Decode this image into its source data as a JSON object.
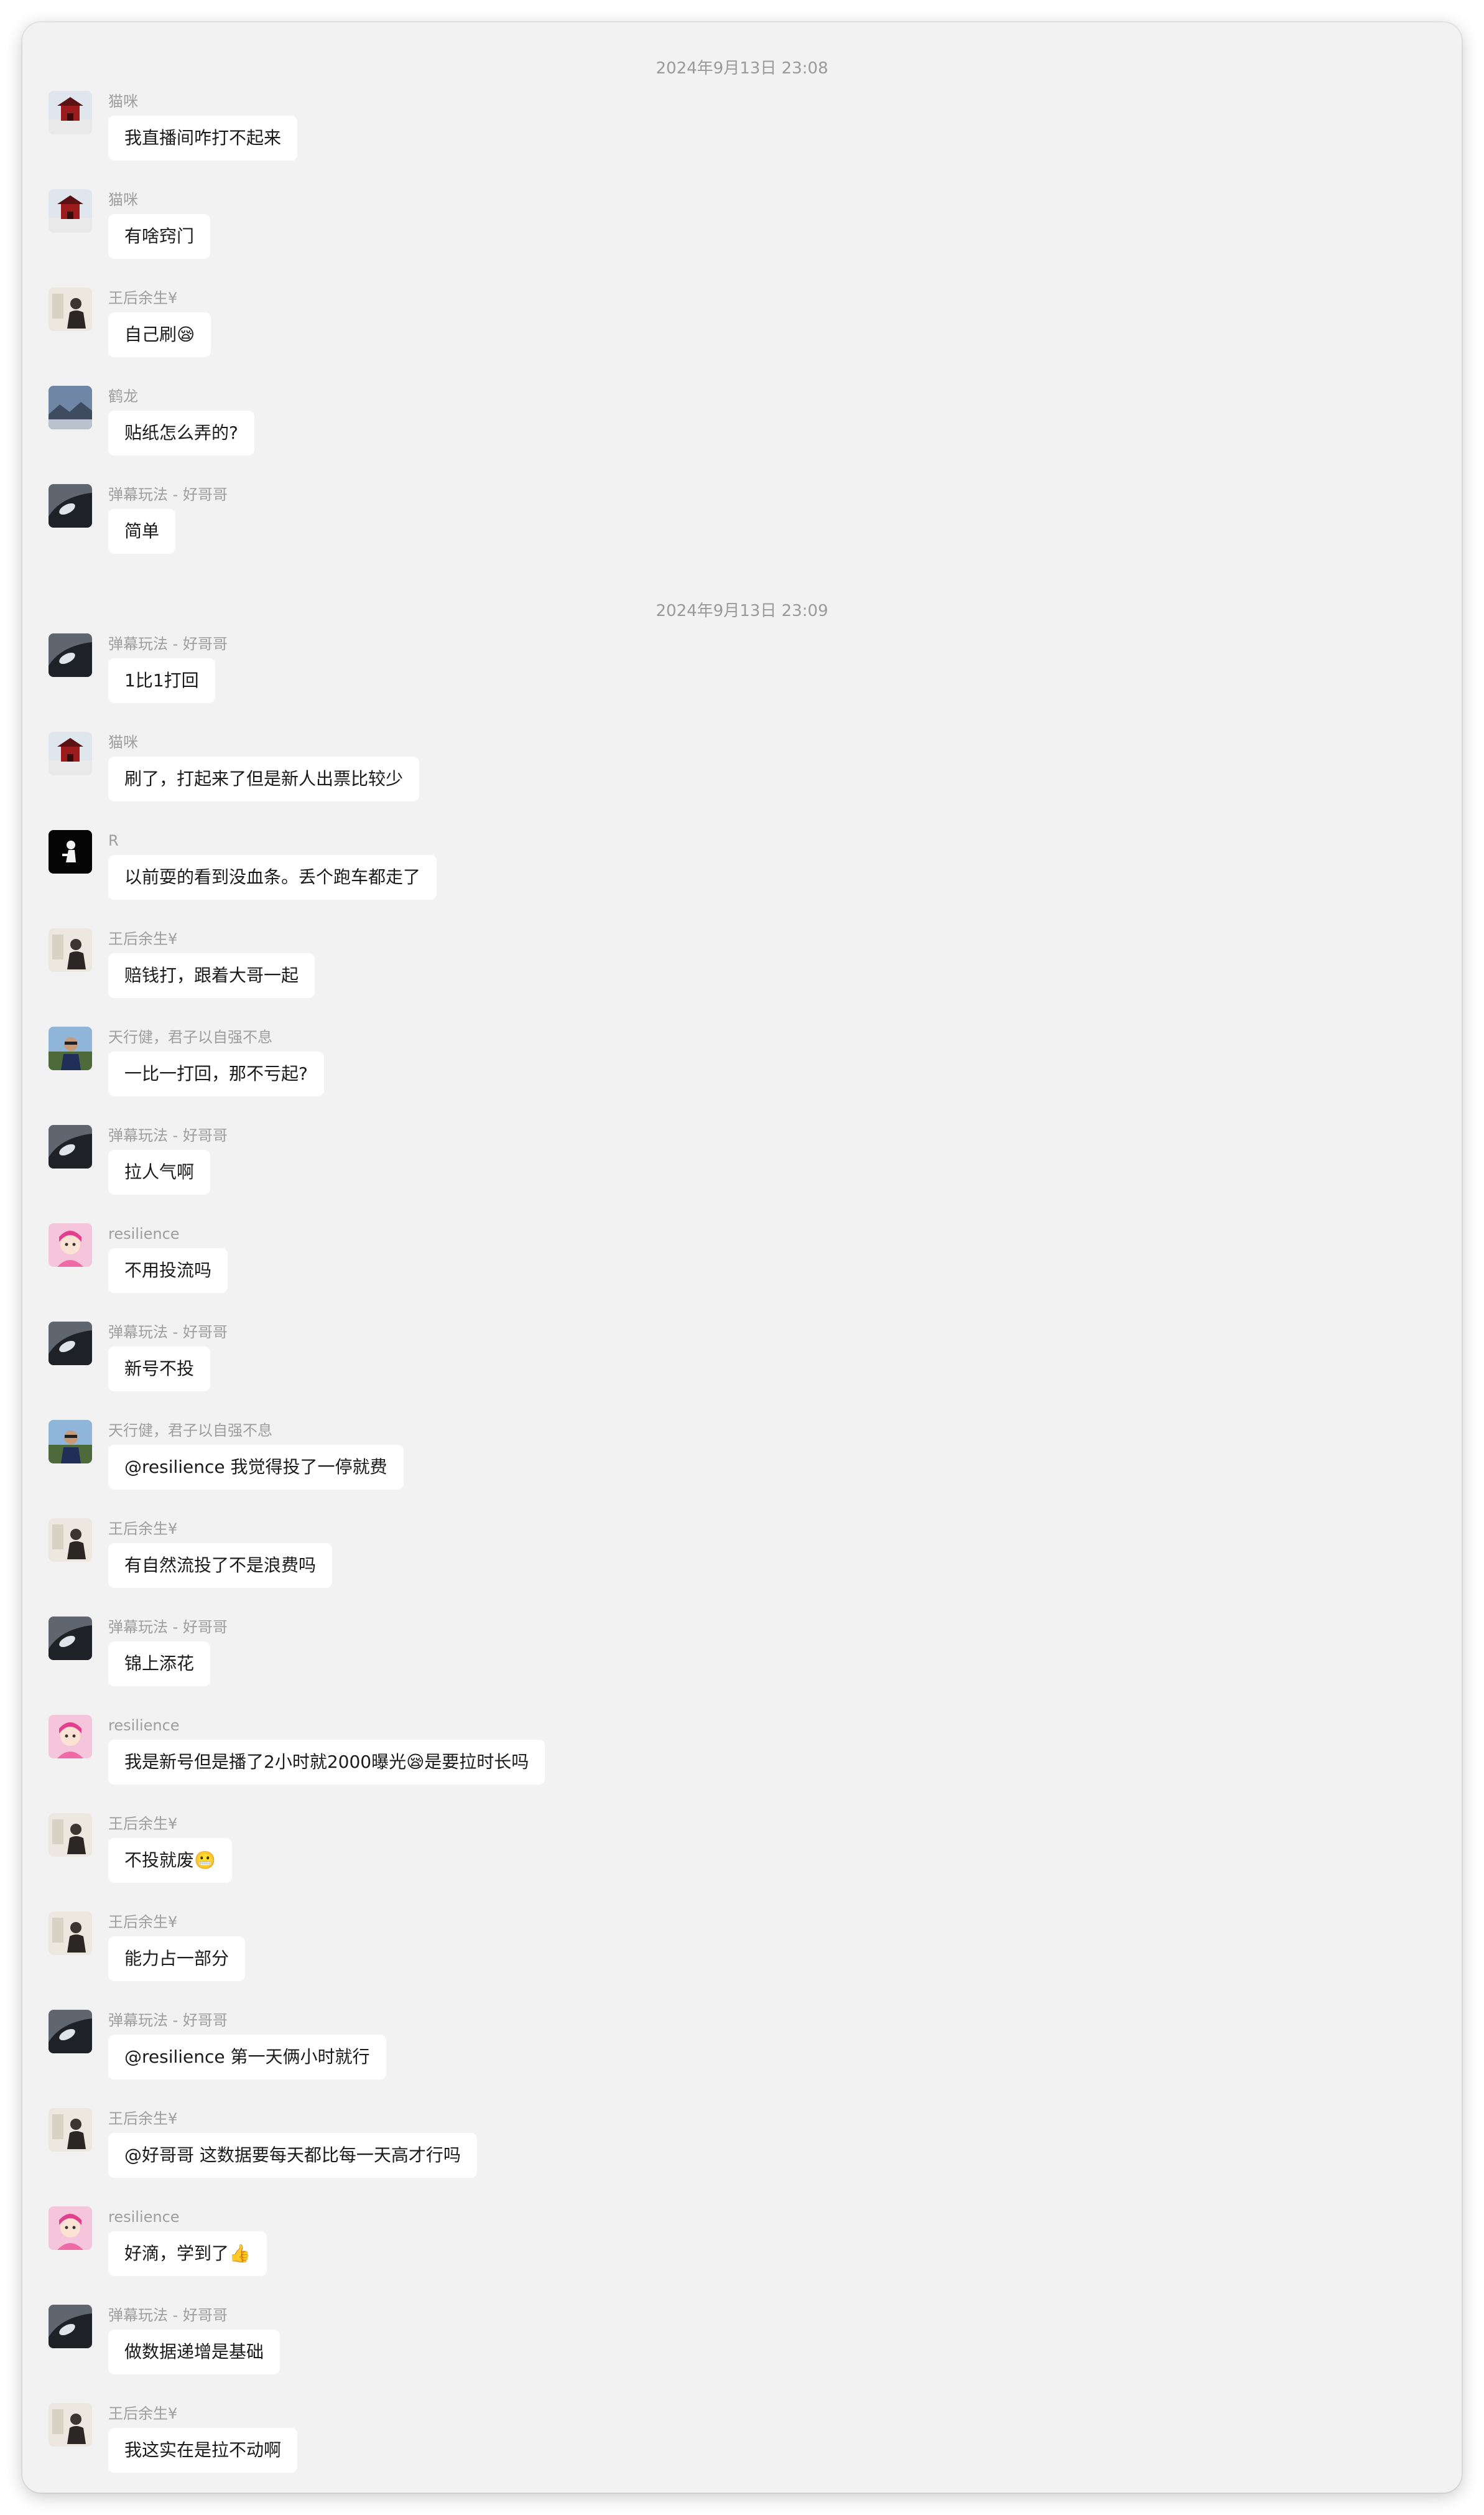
{
  "timestamps": [
    "2024年9月13日 23:08",
    "2024年9月13日 23:09"
  ],
  "messages": [
    {
      "sender": "猫咪",
      "text": "我直播间咋打不起来",
      "avatar": "red-building-avatar"
    },
    {
      "sender": "猫咪",
      "text": "有啥窍门",
      "avatar": "red-building-avatar"
    },
    {
      "sender": "王后余生¥",
      "text": "自己刷😪",
      "avatar": "person-sitting-avatar"
    },
    {
      "sender": "鹤龙",
      "text": "贴纸怎么弄的?",
      "avatar": "landscape-avatar"
    },
    {
      "sender": "弹幕玩法 - 好哥哥",
      "text": "简单",
      "avatar": "car-headlight-avatar"
    },
    {
      "sender": "弹幕玩法 - 好哥哥",
      "text": "1比1打回",
      "avatar": "car-headlight-avatar"
    },
    {
      "sender": "猫咪",
      "text": "刷了，打起来了但是新人出票比较少",
      "avatar": "red-building-avatar"
    },
    {
      "sender": "R",
      "text": "以前耍的看到没血条。丢个跑车都走了",
      "avatar": "black-figure-avatar"
    },
    {
      "sender": "王后余生¥",
      "text": "赔钱打，跟着大哥一起",
      "avatar": "person-sitting-avatar"
    },
    {
      "sender": "天行健，君子以自强不息",
      "text": "一比一打回，那不亏起?",
      "avatar": "man-outdoor-avatar"
    },
    {
      "sender": "弹幕玩法 - 好哥哥",
      "text": "拉人气啊",
      "avatar": "car-headlight-avatar"
    },
    {
      "sender": "resilience",
      "text": "不用投流吗",
      "avatar": "pink-girl-avatar"
    },
    {
      "sender": "弹幕玩法 - 好哥哥",
      "text": "新号不投",
      "avatar": "car-headlight-avatar"
    },
    {
      "sender": "天行健，君子以自强不息",
      "text": "@resilience 我觉得投了一停就费",
      "avatar": "man-outdoor-avatar"
    },
    {
      "sender": "王后余生¥",
      "text": "有自然流投了不是浪费吗",
      "avatar": "person-sitting-avatar"
    },
    {
      "sender": "弹幕玩法 - 好哥哥",
      "text": "锦上添花",
      "avatar": "car-headlight-avatar"
    },
    {
      "sender": "resilience",
      "text": "我是新号但是播了2小时就2000曝光😪是要拉时长吗",
      "avatar": "pink-girl-avatar"
    },
    {
      "sender": "王后余生¥",
      "text": "不投就废😬",
      "avatar": "person-sitting-avatar"
    },
    {
      "sender": "王后余生¥",
      "text": "能力占一部分",
      "avatar": "person-sitting-avatar"
    },
    {
      "sender": "弹幕玩法 - 好哥哥",
      "text": "@resilience 第一天俩小时就行",
      "avatar": "car-headlight-avatar"
    },
    {
      "sender": "王后余生¥",
      "text": "@好哥哥 这数据要每天都比每一天高才行吗",
      "avatar": "person-sitting-avatar"
    },
    {
      "sender": "resilience",
      "text": "好滴，学到了👍",
      "avatar": "pink-girl-avatar"
    },
    {
      "sender": "弹幕玩法 - 好哥哥",
      "text": "做数据递增是基础",
      "avatar": "car-headlight-avatar"
    },
    {
      "sender": "王后余生¥",
      "text": "我这实在是拉不动啊",
      "avatar": "person-sitting-avatar"
    }
  ]
}
